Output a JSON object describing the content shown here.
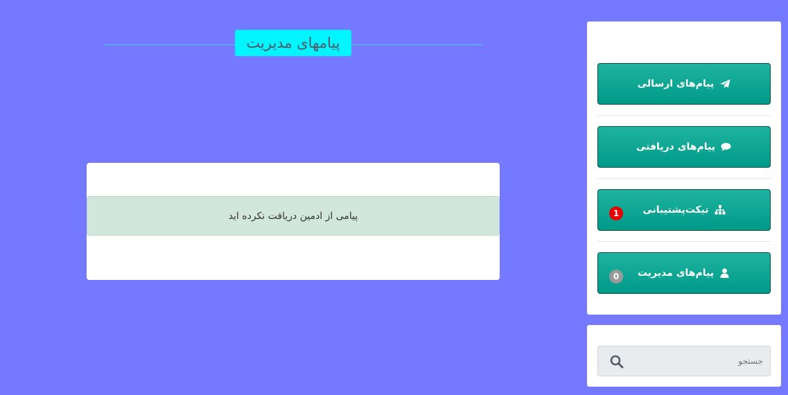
{
  "page": {
    "title": "پیامهای مدیریت",
    "empty_message": "پیامی از ادمین دریافت نکرده اید"
  },
  "sidebar": {
    "items": [
      {
        "label": "پیام‌های ارسالی",
        "icon": "paper-plane-icon"
      },
      {
        "label": "پیام‌های دریافتی",
        "icon": "comment-icon"
      },
      {
        "label": "تیکت‌پشتیبانی",
        "icon": "sitemap-icon",
        "badge": "1",
        "badge_color": "#e80000"
      },
      {
        "label": "پیام‌های مدیریت",
        "icon": "user-icon",
        "badge": "0",
        "badge_color": "#9a9a9a"
      }
    ]
  },
  "search": {
    "placeholder": "جستجو"
  },
  "colors": {
    "background": "#7579ff",
    "accent_title": "#00f5ff",
    "button_gradient_top": "#1eb3a0",
    "button_gradient_bottom": "#009a88",
    "alert_bg": "#d1e7dd"
  }
}
